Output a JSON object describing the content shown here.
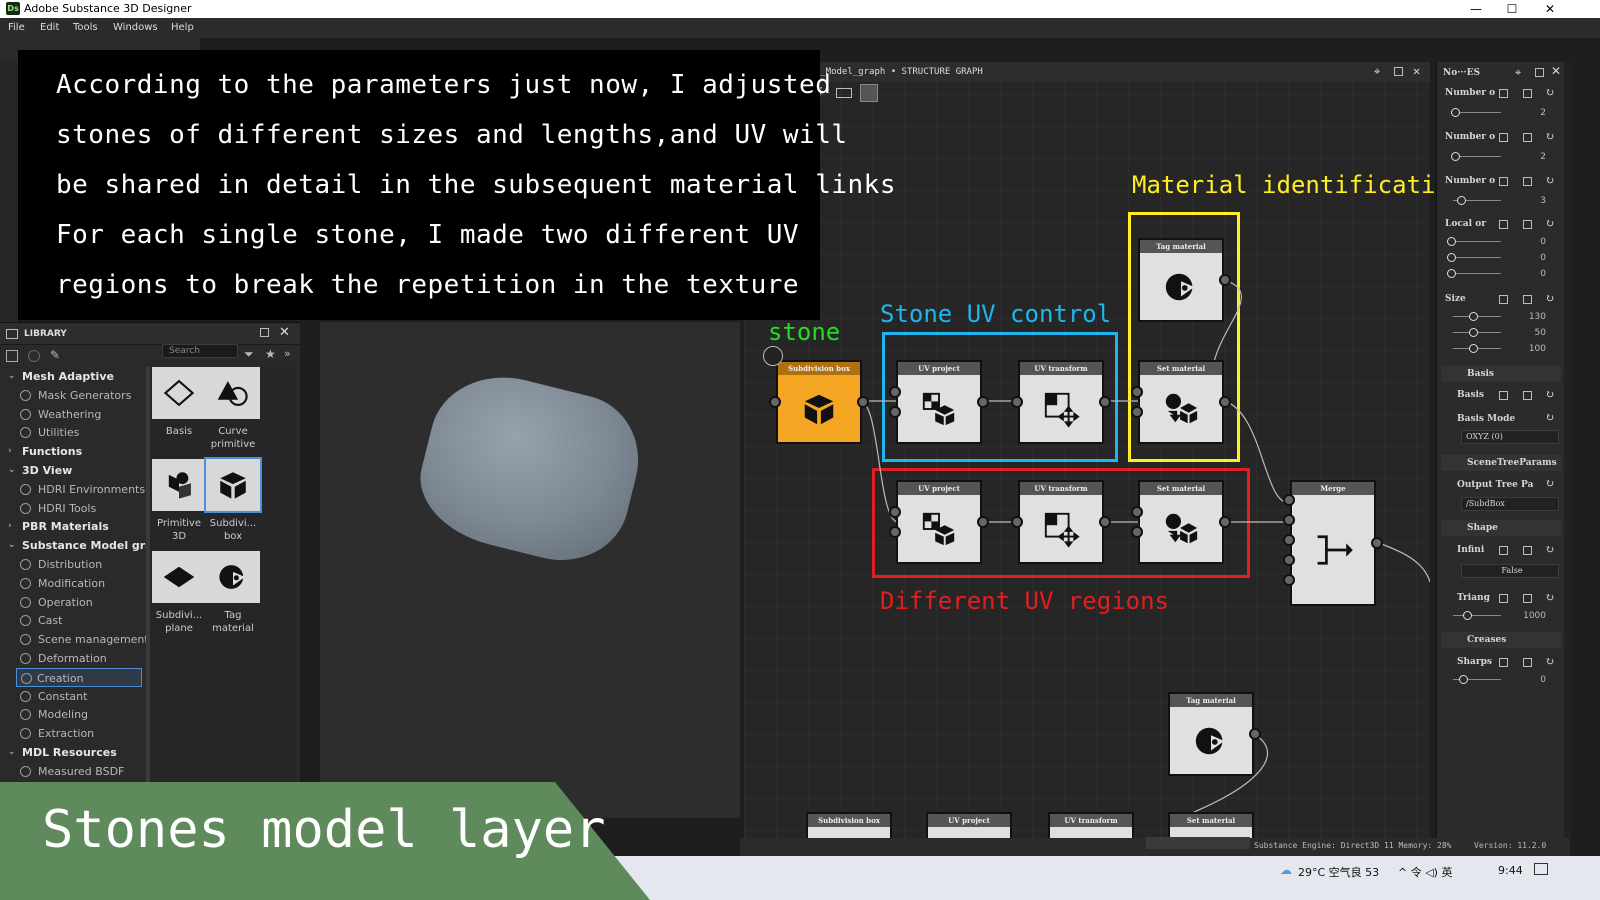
{
  "app": {
    "title": "Adobe Substance 3D Designer",
    "logo": "Ds"
  },
  "window_controls": {
    "minimize": "—",
    "maximize": "☐",
    "close": "✕"
  },
  "menu": [
    "File",
    "Edit",
    "Tools",
    "Windows",
    "Help"
  ],
  "caption": {
    "lines": [
      "According to the parameters just now, I adjusted",
      "stones of different sizes and lengths,and UV will",
      "be shared in detail in the subsequent material links",
      "For each single stone, I made two different UV",
      "regions to break the repetition in the texture"
    ]
  },
  "library": {
    "title": "LIBRARY",
    "search_placeholder": "Search",
    "tree": [
      {
        "label": "Mesh Adaptive",
        "type": "category",
        "expanded": true
      },
      {
        "label": "Mask Generators",
        "type": "item"
      },
      {
        "label": "Weathering",
        "type": "item"
      },
      {
        "label": "Utilities",
        "type": "item"
      },
      {
        "label": "Functions",
        "type": "category",
        "expanded": false
      },
      {
        "label": "3D View",
        "type": "category",
        "expanded": true
      },
      {
        "label": "HDRI Environments",
        "type": "item"
      },
      {
        "label": "HDRI Tools",
        "type": "item"
      },
      {
        "label": "PBR Materials",
        "type": "category",
        "expanded": false
      },
      {
        "label": "Substance Model gra...",
        "type": "category",
        "expanded": true
      },
      {
        "label": "Distribution",
        "type": "item"
      },
      {
        "label": "Modification",
        "type": "item"
      },
      {
        "label": "Operation",
        "type": "item"
      },
      {
        "label": "Cast",
        "type": "item"
      },
      {
        "label": "Scene management",
        "type": "item"
      },
      {
        "label": "Deformation",
        "type": "item"
      },
      {
        "label": "Creation",
        "type": "item",
        "selected": true
      },
      {
        "label": "Constant",
        "type": "item"
      },
      {
        "label": "Modeling",
        "type": "item"
      },
      {
        "label": "Extraction",
        "type": "item"
      },
      {
        "label": "MDL Resources",
        "type": "category",
        "expanded": true
      },
      {
        "label": "Measured BSDF",
        "type": "item"
      }
    ],
    "grid": [
      {
        "label": "Basis",
        "icon": "diamond-icon"
      },
      {
        "label": "Curve primitive",
        "icon": "curve-primitive-icon"
      },
      {
        "label": "Primitive 3D",
        "icon": "primitive-3d-icon"
      },
      {
        "label": "Subdivi... box",
        "icon": "cube-icon",
        "selected": true
      },
      {
        "label": "Subdivi... plane",
        "icon": "plane-icon"
      },
      {
        "label": "Tag material",
        "icon": "tag-material-icon"
      }
    ]
  },
  "graph": {
    "title": "ace_Model_graph  •  STRUCTURE GRAPH",
    "nodes": {
      "subdivision_box": "Subdivision box",
      "uv_project": "UV project",
      "uv_transform": "UV transform",
      "tag_material": "Tag material",
      "set_material": "Set material",
      "merge": "Merge"
    },
    "annotations": {
      "stone": "stone",
      "stone_uv_control": "Stone UV control",
      "material_identification": "Material identification",
      "different_uv_regions": "Different UV regions"
    },
    "colors": {
      "stone": "#22dd22",
      "uv_control": "#1fb6f0",
      "material": "#ffee22",
      "regions": "#e41e1e",
      "subdiv_node": "#f5a623"
    }
  },
  "properties": {
    "title": "No···ES",
    "rows": [
      {
        "label": "Number o",
        "value": "2"
      },
      {
        "label": "Number o",
        "value": "2"
      },
      {
        "label": "Number o",
        "value": "3"
      },
      {
        "label": "Local or",
        "values": [
          "0",
          "0",
          "0"
        ]
      },
      {
        "label": "Size",
        "values": [
          "130",
          "50",
          "100"
        ]
      }
    ],
    "sections": {
      "basis": "Basis",
      "scene": "SceneTreeParams",
      "shape": "Shape",
      "creases": "Creases"
    },
    "basis_label": "Basis",
    "basis_mode_label": "Basis Mode",
    "basis_mode_value": "OXYZ (0)",
    "output_tree_label": "Output Tree Pa",
    "output_tree_value": "/SubdBox",
    "infinite_label": "Infini",
    "infinite_value": "False",
    "triang_label": "Triang",
    "triang_value": "1000",
    "sharps_label": "Sharps",
    "sharps_value": "0"
  },
  "status": {
    "engine": "Substance Engine: Direct3D 11 Memory: 28%",
    "version": "Version: 11.2.0"
  },
  "taskbar": {
    "weather": "29°C 空气良 53",
    "tray": "^ 令 ◁) 英",
    "time": "9:44"
  },
  "banner": {
    "text": "Stones model layer"
  }
}
